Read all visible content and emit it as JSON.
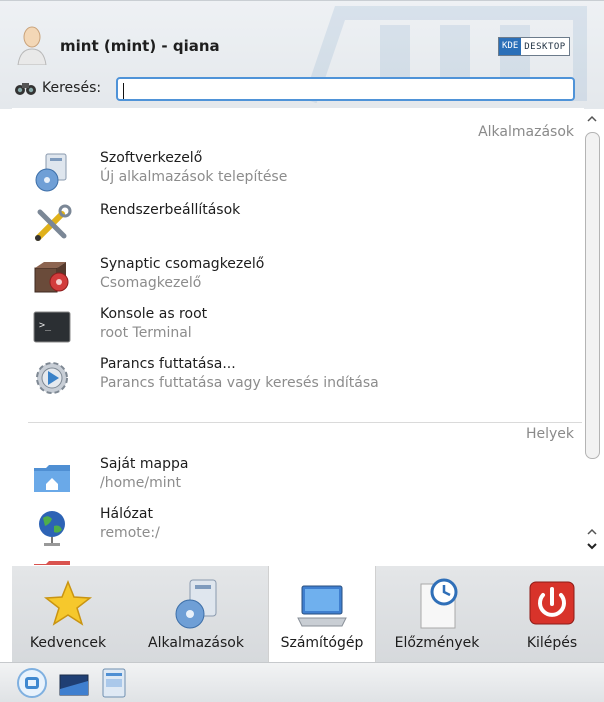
{
  "header": {
    "user_title": "mint (mint) - qiana",
    "badge_kde": "KDE",
    "badge_desktop": "DESKTOP",
    "search_label": "Keresés:",
    "search_value": "",
    "search_placeholder": ""
  },
  "sections": {
    "apps_title": "Alkalmazások",
    "places_title": "Helyek"
  },
  "apps": [
    {
      "name": "Szoftverkezelő",
      "desc": "Új alkalmazások telepítése",
      "icon": "software-manager-icon"
    },
    {
      "name": "Rendszerbeállítások",
      "desc": "",
      "icon": "system-settings-icon"
    },
    {
      "name": "Synaptic csomagkezelő",
      "desc": "Csomagkezelő",
      "icon": "synaptic-icon"
    },
    {
      "name": "Konsole as root",
      "desc": "root Terminal",
      "icon": "terminal-icon"
    },
    {
      "name": "Parancs futtatása...",
      "desc": "Parancs futtatása vagy keresés indítása",
      "icon": "run-command-icon"
    }
  ],
  "places": [
    {
      "name": "Saját mappa",
      "desc": "/home/mint",
      "icon": "home-folder-icon"
    },
    {
      "name": "Hálózat",
      "desc": "remote:/",
      "icon": "network-globe-icon"
    }
  ],
  "tabs": [
    {
      "label": "Kedvencek",
      "icon": "star-icon",
      "active": false
    },
    {
      "label": "Alkalmazások",
      "icon": "applications-icon",
      "active": false
    },
    {
      "label": "Számítógép",
      "icon": "computer-icon",
      "active": true
    },
    {
      "label": "Előzmények",
      "icon": "history-clock-icon",
      "active": false
    },
    {
      "label": "Kilépés",
      "icon": "power-icon",
      "active": false
    }
  ],
  "colors": {
    "focus_border": "#4f93d8",
    "secondary_text": "#8c8c8c",
    "power_red": "#d8332a"
  }
}
